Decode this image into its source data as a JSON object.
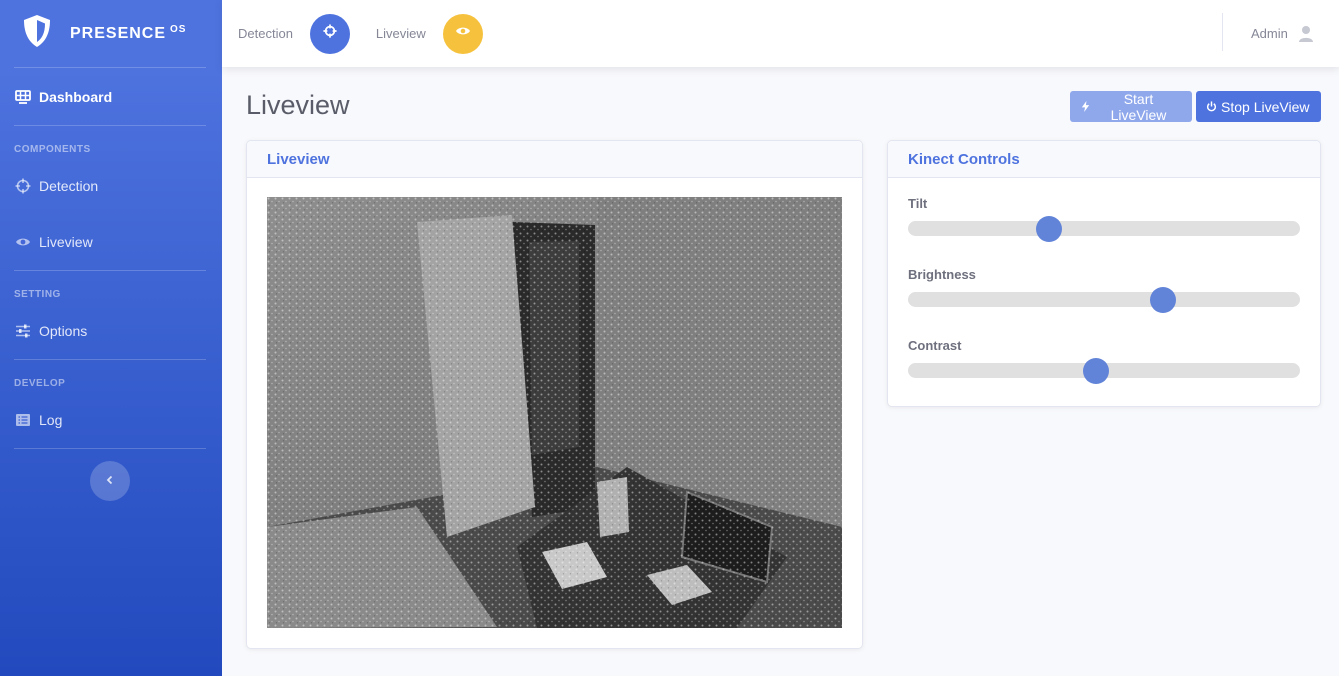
{
  "brand": {
    "name": "PRESENCE",
    "suffix": "OS"
  },
  "sidebar": {
    "dashboard": "Dashboard",
    "sections": [
      {
        "heading": "COMPONENTS",
        "items": [
          "Detection",
          "Liveview"
        ]
      },
      {
        "heading": "SETTING",
        "items": [
          "Options"
        ]
      },
      {
        "heading": "DEVELOP",
        "items": [
          "Log"
        ]
      }
    ]
  },
  "topbar": {
    "detection_label": "Detection",
    "liveview_label": "Liveview",
    "user": "Admin",
    "detection_color": "#4e73df",
    "liveview_color": "#f6c23e"
  },
  "page": {
    "title": "Liveview",
    "start_label": "Start LiveView",
    "stop_label": "Stop LiveView"
  },
  "liveview_card": {
    "title": "Liveview"
  },
  "controls_card": {
    "title": "Kinect Controls",
    "sliders": [
      {
        "label": "Tilt",
        "value": 0.36
      },
      {
        "label": "Brightness",
        "value": 0.65
      },
      {
        "label": "Contrast",
        "value": 0.48
      }
    ]
  },
  "colors": {
    "accent": "#4e73df",
    "warning": "#f6c23e"
  }
}
